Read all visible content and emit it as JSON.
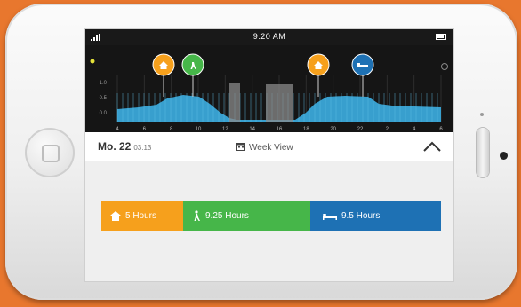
{
  "status_bar": {
    "time": "9:20 AM"
  },
  "chart_data": {
    "type": "area",
    "x_tick_labels": [
      "4",
      "6",
      "8",
      "10",
      "12",
      "14",
      "16",
      "18",
      "20",
      "22",
      "2",
      "4",
      "6"
    ],
    "y_tick_labels": [
      "1.0",
      "0.5",
      "0.0"
    ],
    "colors": {
      "area": "#3aa6d8",
      "highlight": "#8a8a8a",
      "home": "#f6a01c",
      "walk": "#46b649",
      "sleep": "#1e71b4"
    },
    "markers": [
      {
        "icon": "home-icon",
        "color": "#f6a01c"
      },
      {
        "icon": "walk-icon",
        "color": "#46b649"
      },
      {
        "icon": "home-icon",
        "color": "#f6a01c"
      },
      {
        "icon": "bed-icon",
        "color": "#1e71b4"
      }
    ]
  },
  "summary": {
    "date": "Mo. 22",
    "date_small": "03.13",
    "view_label": "Week View"
  },
  "activity": [
    {
      "icon": "home-icon",
      "label": "5 Hours",
      "color": "#f6a01c"
    },
    {
      "icon": "walk-icon",
      "label": "9.25 Hours",
      "color": "#46b649"
    },
    {
      "icon": "bed-icon",
      "label": "9.5 Hours",
      "color": "#1e71b4"
    }
  ]
}
